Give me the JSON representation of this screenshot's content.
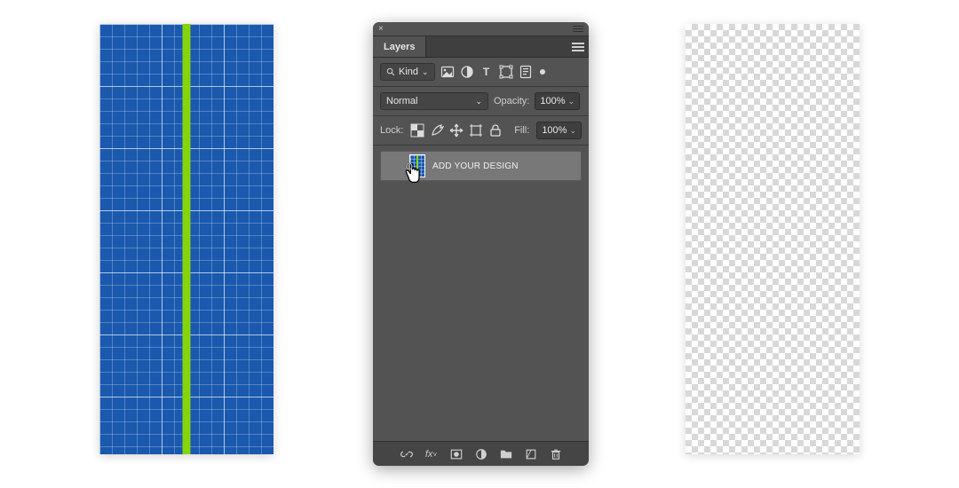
{
  "panel": {
    "title": "Layers",
    "filter": {
      "mode": "Kind"
    },
    "blend": {
      "mode": "Normal",
      "opacity_label": "Opacity:",
      "opacity_value": "100%"
    },
    "lock": {
      "label": "Lock:",
      "fill_label": "Fill:",
      "fill_value": "100%"
    },
    "layer": {
      "name": "ADD YOUR DESIGN"
    }
  },
  "icons": {
    "close": "×",
    "chev": "⌄",
    "search": "search",
    "image": "image",
    "adjust": "adjust",
    "type": "T",
    "shape": "shape",
    "smart": "smart",
    "artboard": "artboard",
    "lock_trans": "trans",
    "lock_brush": "brush",
    "lock_move": "move",
    "lock_frame": "frame",
    "lock_pad": "lock",
    "link": "link",
    "fx": "fx",
    "mask": "mask",
    "adjustment": "circle",
    "group": "folder",
    "new": "new",
    "trash": "trash"
  }
}
